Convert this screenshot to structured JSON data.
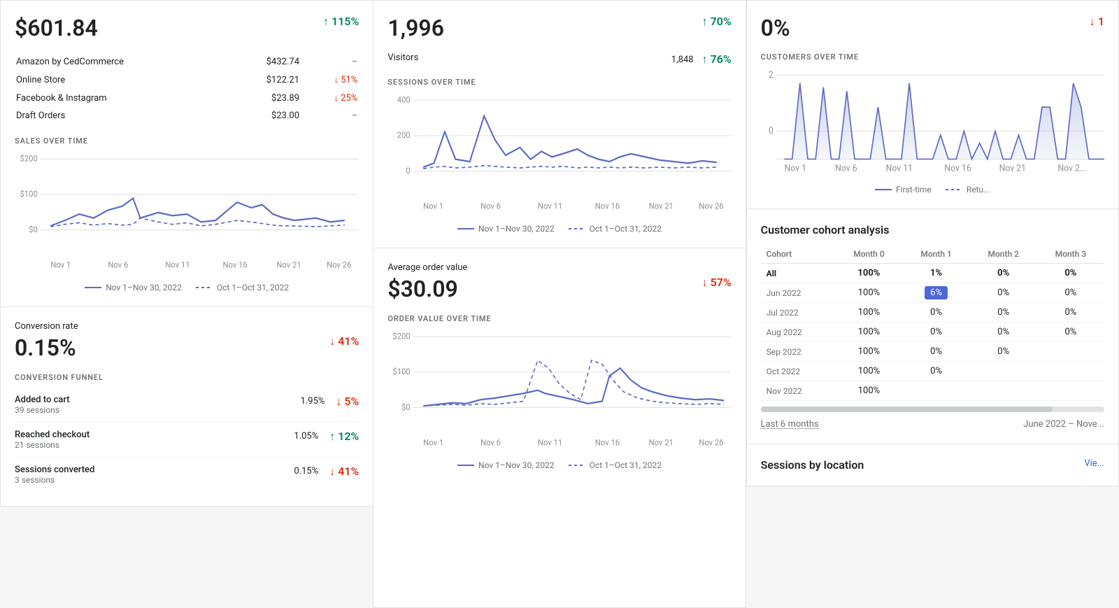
{
  "panels": {
    "sales": {
      "total": "$601.84",
      "change": "↑ 115%",
      "change_type": "positive",
      "rows": [
        {
          "label": "Amazon by CedCommerce",
          "value": "$432.74",
          "change": "–",
          "change_type": "neutral"
        },
        {
          "label": "Online Store",
          "value": "$122.21",
          "change": "↓ 51%",
          "change_type": "negative"
        },
        {
          "label": "Facebook & Instagram",
          "value": "$23.89",
          "change": "↓ 25%",
          "change_type": "negative"
        },
        {
          "label": "Draft Orders",
          "value": "$23.00",
          "change": "–",
          "change_type": "neutral"
        }
      ],
      "section_title": "SALES OVER TIME",
      "legend": {
        "item1": "Nov 1–Nov 30, 2022",
        "item2": "Oct 1–Oct 31, 2022"
      },
      "x_labels": [
        "Nov 1",
        "Nov 6",
        "Nov 11",
        "Nov 16",
        "Nov 21",
        "Nov 26"
      ],
      "y_labels": [
        "$200",
        "$100",
        "$0"
      ]
    },
    "conversion": {
      "label": "Conversion rate",
      "value": "0.15%",
      "change": "↓ 41%",
      "change_type": "negative",
      "section_title": "CONVERSION FUNNEL",
      "funnel_rows": [
        {
          "label": "Added to cart",
          "sub": "39 sessions",
          "pct": "1.95%",
          "change": "↓ 5%",
          "change_type": "negative"
        },
        {
          "label": "Reached checkout",
          "sub": "21 sessions",
          "pct": "1.05%",
          "change": "↑ 12%",
          "change_type": "positive"
        },
        {
          "label": "Sessions converted",
          "sub": "3 sessions",
          "pct": "0.15%",
          "change": "↓ 41%",
          "change_type": "negative"
        }
      ]
    },
    "sessions": {
      "total": "1,996",
      "change": "↑ 70%",
      "change_type": "positive",
      "visitors_label": "Visitors",
      "visitors_value": "1,848",
      "visitors_change": "↑ 76%",
      "visitors_change_type": "positive",
      "section_title": "SESSIONS OVER TIME",
      "legend": {
        "item1": "Nov 1–Nov 30, 2022",
        "item2": "Oct 1–Oct 31, 2022"
      },
      "x_labels": [
        "Nov 1",
        "Nov 6",
        "Nov 11",
        "Nov 16",
        "Nov 21",
        "Nov 26"
      ],
      "y_labels": [
        "400",
        "200",
        "0"
      ]
    },
    "avg_order": {
      "label": "Average order value",
      "value": "$30.09",
      "change": "↓ 57%",
      "change_type": "negative",
      "section_title": "ORDER VALUE OVER TIME",
      "legend": {
        "item1": "Nov 1–Nov 30, 2022",
        "item2": "Oct 1–Oct 31, 2022"
      },
      "x_labels": [
        "Nov 1",
        "Nov 6",
        "Nov 11",
        "Nov 16",
        "Nov 21",
        "Nov 26"
      ],
      "y_labels": [
        "$200",
        "$100",
        "$0"
      ]
    },
    "customers": {
      "title": "0%",
      "change": "↓ 1",
      "change_type": "negative",
      "section_title": "CUSTOMERS OVER TIME",
      "y_labels": [
        "2",
        "0"
      ],
      "x_labels": [
        "Nov 1",
        "Nov 6",
        "Nov 11",
        "Nov 16",
        "Nov 21",
        "Nov 2"
      ],
      "legend": {
        "item1": "First-time",
        "item2": "Retu..."
      }
    },
    "cohort": {
      "title": "Customer cohort analysis",
      "headers": [
        "Cohort",
        "Month 0",
        "Month 1",
        "Month 2",
        "Month 3"
      ],
      "rows": [
        {
          "cohort": "All",
          "is_all": true,
          "months": [
            "100%",
            "1%",
            "0%",
            "0%"
          ]
        },
        {
          "cohort": "Jun 2022",
          "is_all": false,
          "months": [
            "100%",
            "6%",
            "0%",
            "0%"
          ],
          "highlight_col": 1
        },
        {
          "cohort": "Jul 2022",
          "is_all": false,
          "months": [
            "100%",
            "0%",
            "0%",
            "0%"
          ]
        },
        {
          "cohort": "Aug 2022",
          "is_all": false,
          "months": [
            "100%",
            "0%",
            "0%",
            "0%"
          ]
        },
        {
          "cohort": "Sep 2022",
          "is_all": false,
          "months": [
            "100%",
            "0%",
            "0%",
            ""
          ]
        },
        {
          "cohort": "Oct 2022",
          "is_all": false,
          "months": [
            "100%",
            "0%",
            "",
            ""
          ]
        },
        {
          "cohort": "Nov 2022",
          "is_all": false,
          "months": [
            "100%",
            "",
            "",
            ""
          ]
        }
      ],
      "footer_left": "Last 6 months",
      "footer_right": "June 2022 – Nove..."
    },
    "sessions_location": {
      "title": "Sessions by location",
      "link": "Vie..."
    }
  }
}
